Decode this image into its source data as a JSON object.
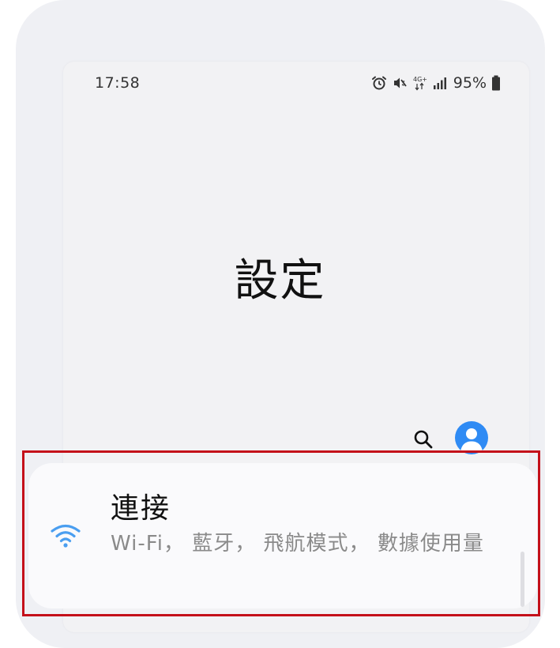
{
  "status_bar": {
    "time": "17:58",
    "network_type": "4G+",
    "battery_percent": "95%",
    "icons": [
      "alarm-icon",
      "mute-icon",
      "network-4g-icon",
      "signal-icon",
      "battery-icon"
    ]
  },
  "header": {
    "title": "設定"
  },
  "toolbar": {
    "search_icon": "search-icon",
    "profile_icon": "account-icon"
  },
  "settings_list": {
    "items": [
      {
        "icon": "wifi-icon",
        "title": "連接",
        "description": "Wi-Fi， 藍牙， 飛航模式， 數據使用量"
      }
    ]
  },
  "colors": {
    "accent": "#2f8bf4",
    "wifi_icon": "#4a9ef0",
    "highlight_border": "#c4101a",
    "background": "#f2f2f4"
  }
}
